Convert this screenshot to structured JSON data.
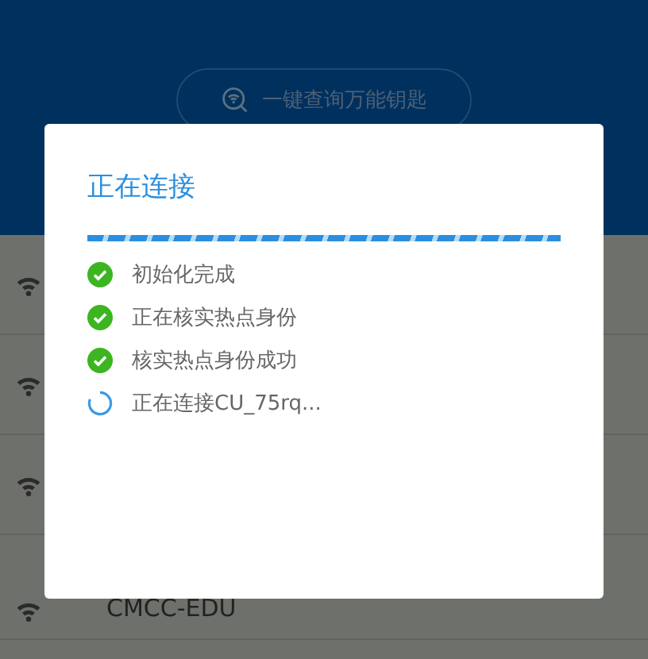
{
  "header": {
    "query_button": "一键查询万能钥匙"
  },
  "progress": {
    "level": 1
  },
  "networks": [
    {
      "name": "CMCC-EDU"
    }
  ],
  "dialog": {
    "title": "正在连接",
    "steps": [
      {
        "kind": "done",
        "label": "初始化完成"
      },
      {
        "kind": "done",
        "label": "正在核实热点身份"
      },
      {
        "kind": "done",
        "label": "核实热点身份成功"
      },
      {
        "kind": "loading",
        "label": "正在连接CU_75rq..."
      }
    ]
  }
}
